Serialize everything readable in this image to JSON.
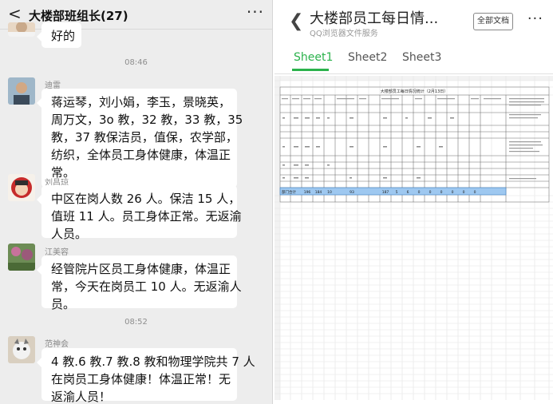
{
  "chat": {
    "title": "大楼部班组长(27)",
    "more": "···",
    "back": "<",
    "partial_message": "好的",
    "time1": "08:46",
    "time2": "08:52",
    "messages": [
      {
        "name": "迪雷",
        "lines": [
          "蒋运琴，刘小娟，李玉，景晓英，",
          "周万文，3o 教，32 教，33 教，35",
          "教，37 教保洁员，值保，农学部，",
          "纺织，全体员工身体健康，体温正",
          "常。"
        ]
      },
      {
        "name": "刘昌琼",
        "lines": [
          "中区在岗人数 26 人。保洁 15 人，",
          "值班 11 人。员工身体正常。无返渝",
          "人员。"
        ]
      },
      {
        "name": "江美容",
        "lines": [
          "经管院片区员工身体健康，体温正",
          "常，今天在岗员工 10 人。无返渝人",
          "员。"
        ]
      },
      {
        "name": "范神会",
        "lines": [
          "4 教.6 教.7 教.8 教和物理学院共 7 人",
          "在岗员工身体健康！体温正常！无",
          "返渝人员！"
        ]
      }
    ]
  },
  "doc": {
    "title": "大楼部员工每日情...",
    "subtitle": "QQ浏览器文件服务",
    "all_docs": "全部文档",
    "more": "···",
    "tabs": [
      "Sheet1",
      "Sheet2",
      "Sheet3"
    ],
    "sheet_title": "大楼部员工每日情况统计（2月13日）",
    "total_label": "部门合计",
    "total_values": [
      "196",
      "184",
      "10",
      "93",
      "187",
      "5",
      "6",
      "0",
      "0",
      "0",
      "0",
      "0",
      "0"
    ],
    "accent_color": "#2bb24c"
  }
}
